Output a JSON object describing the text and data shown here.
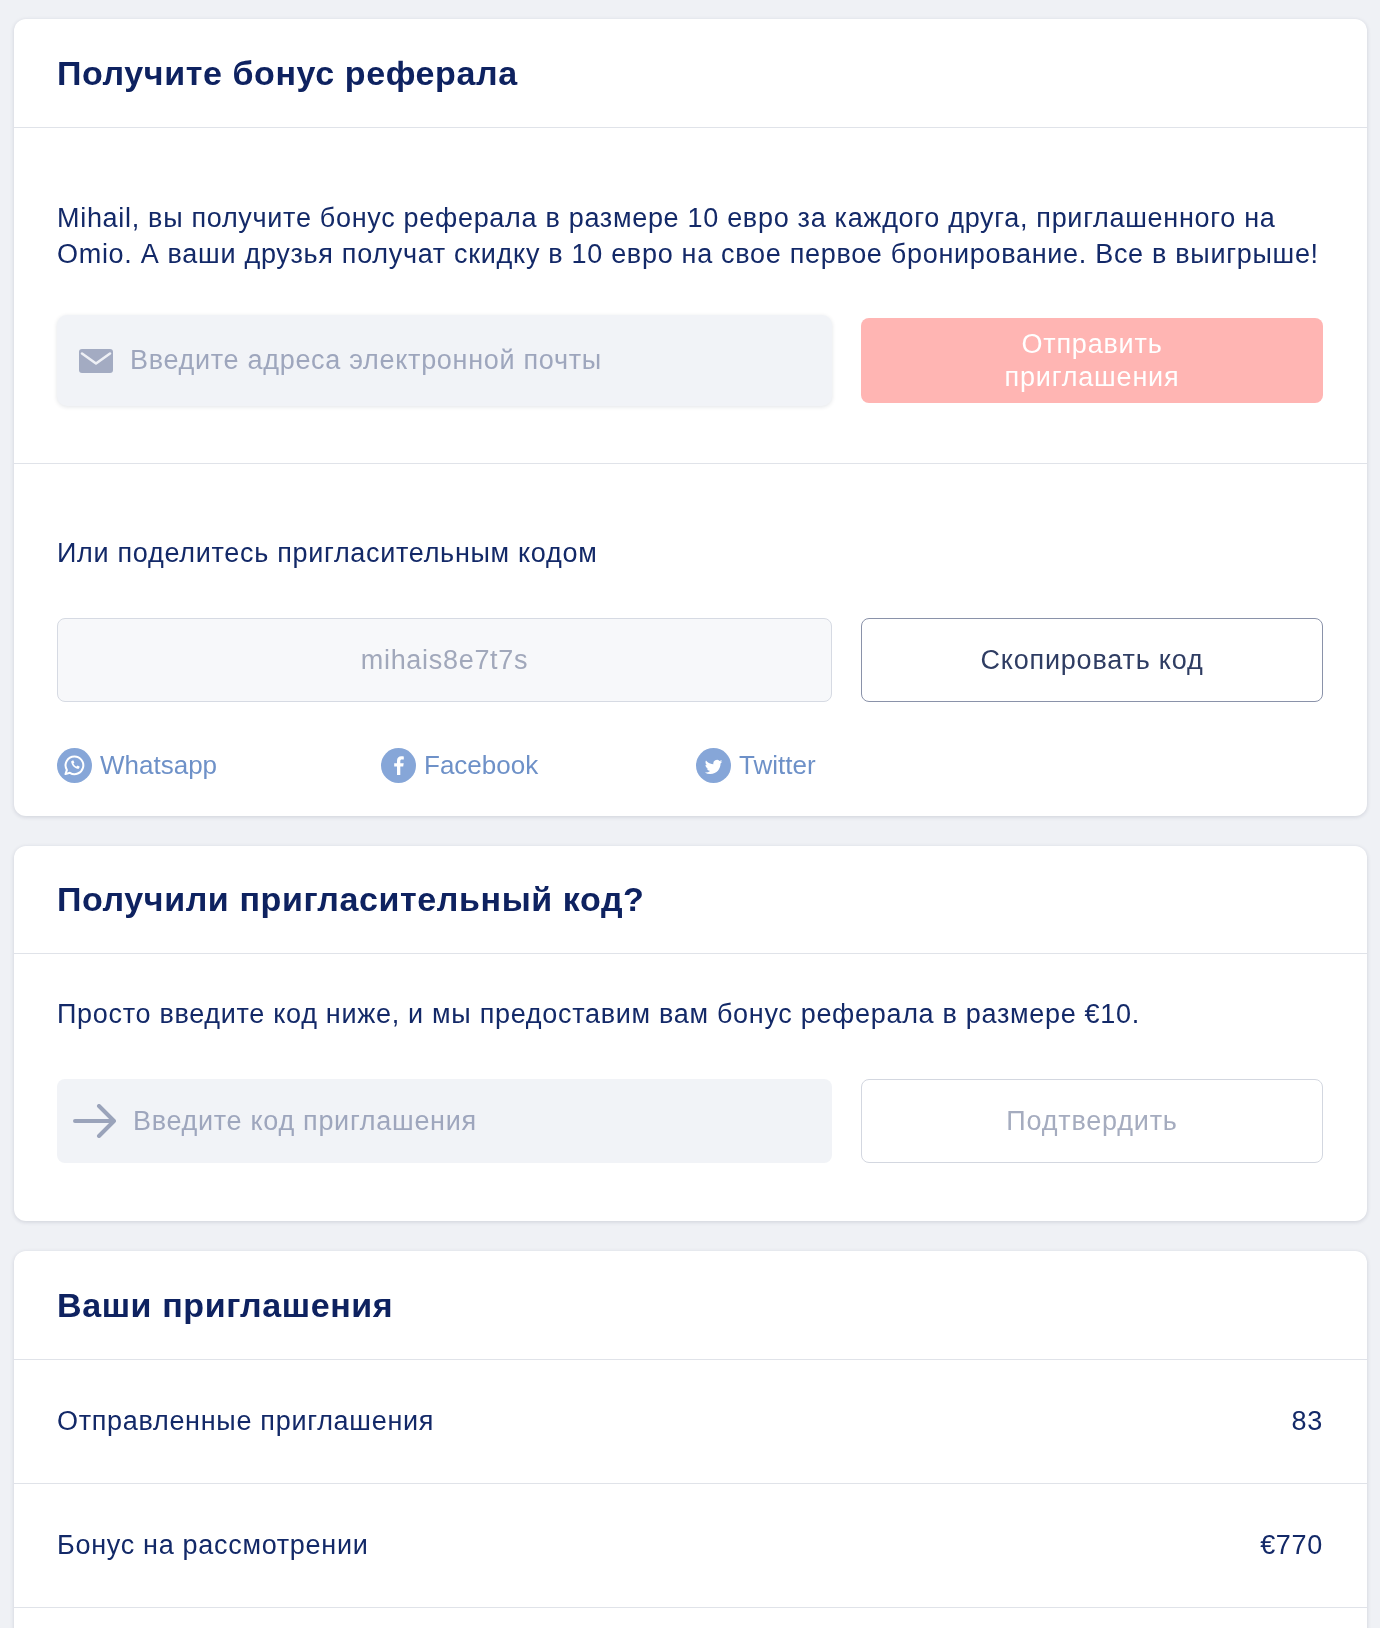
{
  "referral_card": {
    "title": "Получите бонус реферала",
    "description": "Mihail, вы получите бонус реферала в размере 10 евро за каждого друга, приглашенного на Omio. А ваши друзья получат скидку в 10 евро на свое первое бронирование. Все в выигрыше!",
    "email_field": {
      "placeholder": "Введите адреса электронной почты"
    },
    "send_button": {
      "label": "Отправить приглашения",
      "disabled": true
    },
    "share_label": "Или поделитесь пригласительным кодом",
    "code_field": {
      "value": "mihais8e7t7s"
    },
    "copy_button": {
      "label": "Скопировать код",
      "disabled": false
    },
    "share_links": [
      {
        "kind": "whatsapp",
        "label": "Whatsapp"
      },
      {
        "kind": "facebook",
        "label": "Facebook"
      },
      {
        "kind": "twitter",
        "label": "Twitter"
      }
    ]
  },
  "redeem_card": {
    "title": "Получили пригласительный код?",
    "description": "Просто введите код ниже, и мы предоставим вам бонус реферала в размере €10.",
    "code_field": {
      "placeholder": "Введите код приглашения"
    },
    "confirm_button": {
      "label": "Подтвердить",
      "disabled": true
    }
  },
  "invitations_card": {
    "title": "Ваши приглашения",
    "rows": [
      {
        "label": "Отправленные приглашения",
        "value": "83"
      },
      {
        "label": "Бонус на рассмотрении",
        "value": "€770"
      }
    ]
  }
}
